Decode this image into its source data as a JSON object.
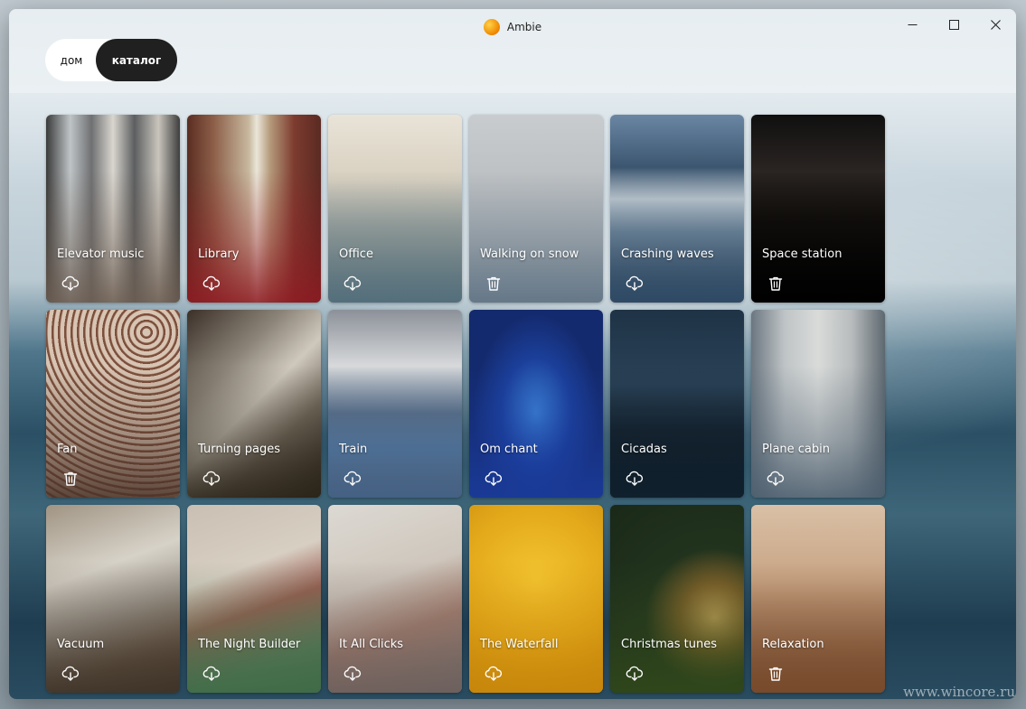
{
  "window": {
    "title": "Ambie",
    "controls": {
      "minimize": "minimize",
      "maximize": "maximize",
      "close": "close"
    }
  },
  "tabs": {
    "home": "дом",
    "catalog": "каталог",
    "selected": "catalog"
  },
  "cards": [
    {
      "id": "elevator-music",
      "title": "Elevator music",
      "action": "download",
      "bg": "linear-gradient(90deg,#3a3a3a 0%,#bfc4c6 18%,#6f7072 34%,#d9d6cf 50%,#5c5e60 66%,#c9c5bd 84%,#3d3d3d 100%)",
      "tint": "#6b5c50"
    },
    {
      "id": "library",
      "title": "Library",
      "action": "download",
      "bg": "linear-gradient(90deg,#5a2d22 0%,#8d5f49 20%,#c7b89e 46%,#eae6d9 52%,#b59a7b 62%,#7d3b2f 80%,#5a2a22 100%)",
      "tint": "#8e1a22"
    },
    {
      "id": "office",
      "title": "Office",
      "action": "download",
      "bg": "linear-gradient(180deg,#e9e4d8 0%,#d8d0c0 35%,#a8aaa2 60%,#7e8782 100%)",
      "tint": "#4d6b7b"
    },
    {
      "id": "walking-on-snow",
      "title": "Walking on snow",
      "action": "delete",
      "bg": "linear-gradient(180deg,#c9ccce 0%,#b7bbbe 50%,#9ea3a8 100%)",
      "tint": "#5d7284"
    },
    {
      "id": "crashing-waves",
      "title": "Crashing waves",
      "action": "download",
      "bg": "linear-gradient(180deg,#6a86a3 0%,#3c5670 28%,#c9d2d8 45%,#7f95a6 62%,#344a5f 100%)",
      "tint": "#2e4a66"
    },
    {
      "id": "space-station",
      "title": "Space station",
      "action": "delete",
      "bg": "linear-gradient(180deg,#101010 0%,#2a2422 30%,#15120f 55%,#050505 100%)",
      "tint": "#000000"
    },
    {
      "id": "fan",
      "title": "Fan",
      "action": "delete",
      "bg": "repeating-radial-gradient(circle at 75% 12%,#d8c4b2 0px,#d8c4b2 4px,#7c4f3c 5px,#7c4f3c 7px)",
      "tint": "#4a3227"
    },
    {
      "id": "turning-pages",
      "title": "Turning pages",
      "action": "download",
      "bg": "linear-gradient(135deg,#3b3028 0%,#8b8378 30%,#cfc8bc 50%,#7a7064 70%,#2f271f 100%)",
      "tint": "#2b2418"
    },
    {
      "id": "train",
      "title": "Train",
      "action": "download",
      "bg": "linear-gradient(180deg,#8c9199 0%,#d7d9db 30%,#5c6f86 55%,#5a7da0 75%,#6b6f74 100%)",
      "tint": "#3e5e86"
    },
    {
      "id": "om-chant",
      "title": "Om chant",
      "action": "download",
      "bg": "radial-gradient(ellipse 70px 110px at 50% 55%,#3e86d8 0%,#1b3f9a 55%,#142a6e 100%)",
      "tint": "#1b3c9c"
    },
    {
      "id": "cicadas",
      "title": "Cicadas",
      "action": "download",
      "bg": "linear-gradient(180deg,#1f3346 0%,#2a4257 40%,#16222e 65%,#0d161f 100%)",
      "tint": "#10212f"
    },
    {
      "id": "plane-cabin",
      "title": "Plane cabin",
      "action": "download",
      "bg": "linear-gradient(90deg,#6b7680 0%,#bfc4c6 25%,#d9dbd9 50%,#b8bcbd 75%,#5d6870 100%)",
      "tint": "#4a5c6c"
    },
    {
      "id": "vacuum",
      "title": "Vacuum",
      "action": "download",
      "bg": "linear-gradient(160deg,#a09483 0%,#d7d2c8 35%,#a7a197 55%,#6e5d4c 80%,#4a3a2c 100%)",
      "tint": "#3e3328"
    },
    {
      "id": "the-night-builder",
      "title": "The Night Builder",
      "action": "download",
      "bg": "linear-gradient(160deg,#c9bfb2 0%,#d8cfc3 35%,#9b5d52 55%,#5f7a5c 80%,#486b4b 100%)",
      "tint": "#3f6b46"
    },
    {
      "id": "it-all-clicks",
      "title": "It All Clicks",
      "action": "download",
      "bg": "linear-gradient(160deg,#dcd9d3 0%,#cfc7bd 40%,#a77f6e 65%,#7b756f 100%)",
      "tint": "#6b5d5a"
    },
    {
      "id": "the-waterfall",
      "title": "The Waterfall",
      "action": "download",
      "bg": "radial-gradient(circle at 50% 40%,#f3c531 0%,#e3a91b 55%,#c98a0c 100%)",
      "tint": "#c7860a"
    },
    {
      "id": "christmas-tunes",
      "title": "Christmas tunes",
      "action": "download",
      "bg": "radial-gradient(circle at 78% 60%,#c8a35a 0%,#7d5f2a 22%,#21331d 45%,#1a2918 100%)",
      "tint": "#324a1b"
    },
    {
      "id": "relaxation",
      "title": "Relaxation",
      "action": "delete",
      "bg": "linear-gradient(180deg,#d9c0a6 0%,#c9a585 40%,#9c7658 70%,#6e4d35 100%)",
      "tint": "#7a4a2a"
    }
  ],
  "watermark": "www.wincore.ru"
}
